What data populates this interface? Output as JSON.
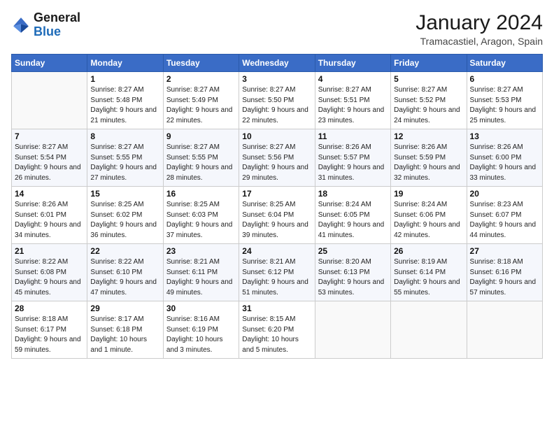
{
  "logo": {
    "line1": "General",
    "line2": "Blue"
  },
  "header": {
    "month": "January 2024",
    "location": "Tramacastiel, Aragon, Spain"
  },
  "weekdays": [
    "Sunday",
    "Monday",
    "Tuesday",
    "Wednesday",
    "Thursday",
    "Friday",
    "Saturday"
  ],
  "weeks": [
    [
      {
        "day": "",
        "sunrise": "",
        "sunset": "",
        "daylight": ""
      },
      {
        "day": "1",
        "sunrise": "Sunrise: 8:27 AM",
        "sunset": "Sunset: 5:48 PM",
        "daylight": "Daylight: 9 hours and 21 minutes."
      },
      {
        "day": "2",
        "sunrise": "Sunrise: 8:27 AM",
        "sunset": "Sunset: 5:49 PM",
        "daylight": "Daylight: 9 hours and 22 minutes."
      },
      {
        "day": "3",
        "sunrise": "Sunrise: 8:27 AM",
        "sunset": "Sunset: 5:50 PM",
        "daylight": "Daylight: 9 hours and 22 minutes."
      },
      {
        "day": "4",
        "sunrise": "Sunrise: 8:27 AM",
        "sunset": "Sunset: 5:51 PM",
        "daylight": "Daylight: 9 hours and 23 minutes."
      },
      {
        "day": "5",
        "sunrise": "Sunrise: 8:27 AM",
        "sunset": "Sunset: 5:52 PM",
        "daylight": "Daylight: 9 hours and 24 minutes."
      },
      {
        "day": "6",
        "sunrise": "Sunrise: 8:27 AM",
        "sunset": "Sunset: 5:53 PM",
        "daylight": "Daylight: 9 hours and 25 minutes."
      }
    ],
    [
      {
        "day": "7",
        "sunrise": "Sunrise: 8:27 AM",
        "sunset": "Sunset: 5:54 PM",
        "daylight": "Daylight: 9 hours and 26 minutes."
      },
      {
        "day": "8",
        "sunrise": "Sunrise: 8:27 AM",
        "sunset": "Sunset: 5:55 PM",
        "daylight": "Daylight: 9 hours and 27 minutes."
      },
      {
        "day": "9",
        "sunrise": "Sunrise: 8:27 AM",
        "sunset": "Sunset: 5:55 PM",
        "daylight": "Daylight: 9 hours and 28 minutes."
      },
      {
        "day": "10",
        "sunrise": "Sunrise: 8:27 AM",
        "sunset": "Sunset: 5:56 PM",
        "daylight": "Daylight: 9 hours and 29 minutes."
      },
      {
        "day": "11",
        "sunrise": "Sunrise: 8:26 AM",
        "sunset": "Sunset: 5:57 PM",
        "daylight": "Daylight: 9 hours and 31 minutes."
      },
      {
        "day": "12",
        "sunrise": "Sunrise: 8:26 AM",
        "sunset": "Sunset: 5:59 PM",
        "daylight": "Daylight: 9 hours and 32 minutes."
      },
      {
        "day": "13",
        "sunrise": "Sunrise: 8:26 AM",
        "sunset": "Sunset: 6:00 PM",
        "daylight": "Daylight: 9 hours and 33 minutes."
      }
    ],
    [
      {
        "day": "14",
        "sunrise": "Sunrise: 8:26 AM",
        "sunset": "Sunset: 6:01 PM",
        "daylight": "Daylight: 9 hours and 34 minutes."
      },
      {
        "day": "15",
        "sunrise": "Sunrise: 8:25 AM",
        "sunset": "Sunset: 6:02 PM",
        "daylight": "Daylight: 9 hours and 36 minutes."
      },
      {
        "day": "16",
        "sunrise": "Sunrise: 8:25 AM",
        "sunset": "Sunset: 6:03 PM",
        "daylight": "Daylight: 9 hours and 37 minutes."
      },
      {
        "day": "17",
        "sunrise": "Sunrise: 8:25 AM",
        "sunset": "Sunset: 6:04 PM",
        "daylight": "Daylight: 9 hours and 39 minutes."
      },
      {
        "day": "18",
        "sunrise": "Sunrise: 8:24 AM",
        "sunset": "Sunset: 6:05 PM",
        "daylight": "Daylight: 9 hours and 41 minutes."
      },
      {
        "day": "19",
        "sunrise": "Sunrise: 8:24 AM",
        "sunset": "Sunset: 6:06 PM",
        "daylight": "Daylight: 9 hours and 42 minutes."
      },
      {
        "day": "20",
        "sunrise": "Sunrise: 8:23 AM",
        "sunset": "Sunset: 6:07 PM",
        "daylight": "Daylight: 9 hours and 44 minutes."
      }
    ],
    [
      {
        "day": "21",
        "sunrise": "Sunrise: 8:22 AM",
        "sunset": "Sunset: 6:08 PM",
        "daylight": "Daylight: 9 hours and 45 minutes."
      },
      {
        "day": "22",
        "sunrise": "Sunrise: 8:22 AM",
        "sunset": "Sunset: 6:10 PM",
        "daylight": "Daylight: 9 hours and 47 minutes."
      },
      {
        "day": "23",
        "sunrise": "Sunrise: 8:21 AM",
        "sunset": "Sunset: 6:11 PM",
        "daylight": "Daylight: 9 hours and 49 minutes."
      },
      {
        "day": "24",
        "sunrise": "Sunrise: 8:21 AM",
        "sunset": "Sunset: 6:12 PM",
        "daylight": "Daylight: 9 hours and 51 minutes."
      },
      {
        "day": "25",
        "sunrise": "Sunrise: 8:20 AM",
        "sunset": "Sunset: 6:13 PM",
        "daylight": "Daylight: 9 hours and 53 minutes."
      },
      {
        "day": "26",
        "sunrise": "Sunrise: 8:19 AM",
        "sunset": "Sunset: 6:14 PM",
        "daylight": "Daylight: 9 hours and 55 minutes."
      },
      {
        "day": "27",
        "sunrise": "Sunrise: 8:18 AM",
        "sunset": "Sunset: 6:16 PM",
        "daylight": "Daylight: 9 hours and 57 minutes."
      }
    ],
    [
      {
        "day": "28",
        "sunrise": "Sunrise: 8:18 AM",
        "sunset": "Sunset: 6:17 PM",
        "daylight": "Daylight: 9 hours and 59 minutes."
      },
      {
        "day": "29",
        "sunrise": "Sunrise: 8:17 AM",
        "sunset": "Sunset: 6:18 PM",
        "daylight": "Daylight: 10 hours and 1 minute."
      },
      {
        "day": "30",
        "sunrise": "Sunrise: 8:16 AM",
        "sunset": "Sunset: 6:19 PM",
        "daylight": "Daylight: 10 hours and 3 minutes."
      },
      {
        "day": "31",
        "sunrise": "Sunrise: 8:15 AM",
        "sunset": "Sunset: 6:20 PM",
        "daylight": "Daylight: 10 hours and 5 minutes."
      },
      {
        "day": "",
        "sunrise": "",
        "sunset": "",
        "daylight": ""
      },
      {
        "day": "",
        "sunrise": "",
        "sunset": "",
        "daylight": ""
      },
      {
        "day": "",
        "sunrise": "",
        "sunset": "",
        "daylight": ""
      }
    ]
  ]
}
